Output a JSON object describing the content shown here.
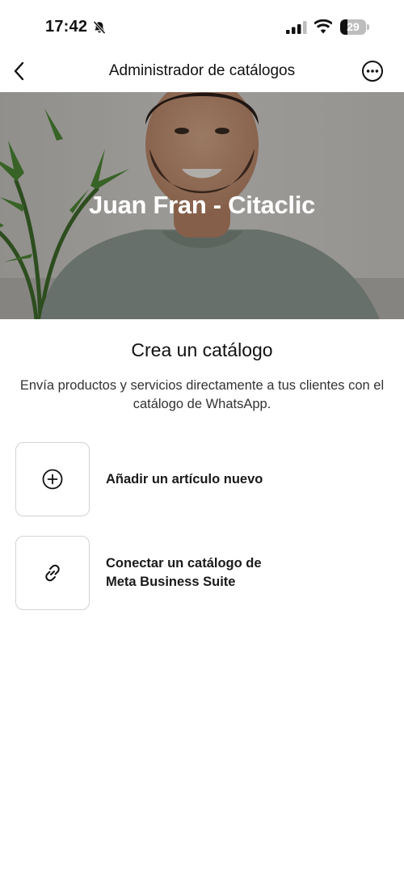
{
  "status_bar": {
    "time": "17:42",
    "battery_level": "29",
    "icons": [
      "bell-slash-icon",
      "signal-icon",
      "wifi-icon",
      "battery-icon"
    ]
  },
  "nav": {
    "title": "Administrador de catálogos",
    "back_icon": "chevron-left-icon",
    "more_icon": "ellipsis-circle-icon"
  },
  "hero": {
    "name": "Juan Fran - Citaclic"
  },
  "content": {
    "title": "Crea un catálogo",
    "description": "Envía productos y servicios directamente a tus clientes con el catálogo de WhatsApp."
  },
  "options": [
    {
      "icon": "plus-circle-icon",
      "label": "Añadir un artículo nuevo"
    },
    {
      "icon": "link-icon",
      "label_line1": "Conectar un catálogo de",
      "label_line2": "Meta Business Suite"
    }
  ],
  "colors": {
    "background": "#ffffff",
    "text": "#111111",
    "border": "#d3d3d3"
  }
}
